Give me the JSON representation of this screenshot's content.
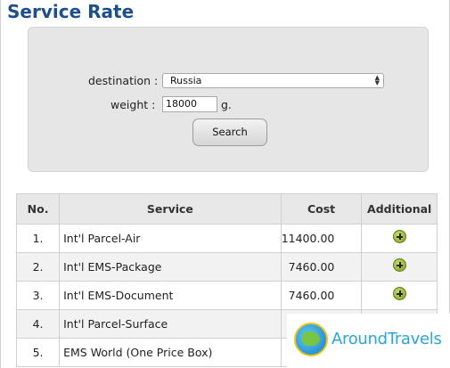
{
  "page": {
    "title": "Service Rate"
  },
  "form": {
    "destination_label": "destination :",
    "destination_value": "Russia",
    "weight_label": "weight :",
    "weight_value": "18000",
    "weight_unit": "g.",
    "search_label": "Search"
  },
  "table": {
    "headers": [
      "No.",
      "Service",
      "Cost",
      "Additional"
    ],
    "rows": [
      {
        "no": "1.",
        "service": "Int'l Parcel-Air",
        "cost": "11400.00"
      },
      {
        "no": "2.",
        "service": "Int'l EMS-Package",
        "cost": "7460.00"
      },
      {
        "no": "3.",
        "service": "Int'l EMS-Document",
        "cost": "7460.00"
      },
      {
        "no": "4.",
        "service": "Int'l Parcel-Surface",
        "cost": ""
      },
      {
        "no": "5.",
        "service": "EMS World (One Price Box)",
        "cost": ""
      }
    ]
  },
  "watermark": {
    "text": "AroundTravels",
    "icon": "globe-logo-icon"
  },
  "colors": {
    "title": "#1d4f8c",
    "plus_icon": "#8fb12e",
    "watermark_text": "#2ba6d8"
  }
}
